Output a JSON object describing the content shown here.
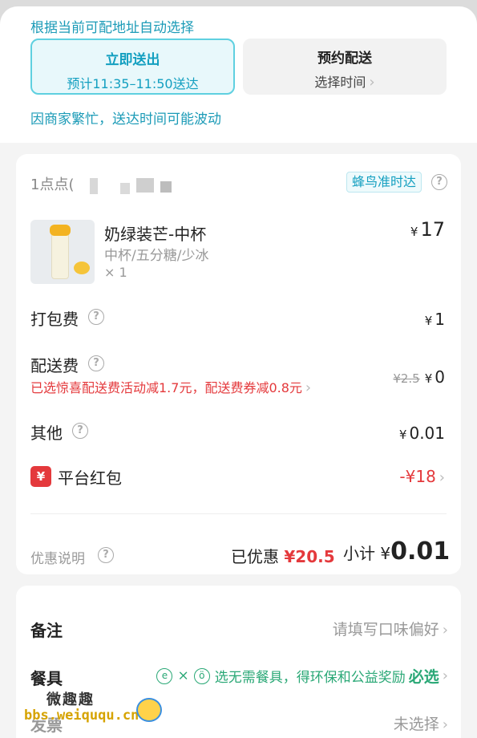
{
  "delivery": {
    "auto_hint": "根据当前可配地址自动选择",
    "now_title": "立即送出",
    "now_sub": "预计11:35–11:50送达",
    "later_title": "预约配送",
    "later_sub": "选择时间",
    "busy_hint": "因商家繁忙，送达时间可能波动"
  },
  "order": {
    "shop_name": "1点点(",
    "badge": "蜂鸟准时达",
    "product": {
      "name": "奶绿装芒-中杯",
      "spec": "中杯/五分糖/少冰",
      "qty": "× 1",
      "currency": "¥",
      "price": "17"
    },
    "packing": {
      "label": "打包费",
      "currency": "¥",
      "value": "1"
    },
    "delivery_fee": {
      "label": "配送费",
      "promo": "已选惊喜配送费活动减1.7元，配送费券减0.8元",
      "old_price": "¥2.5",
      "currency": "¥",
      "value": "0"
    },
    "other": {
      "label": "其他",
      "currency": "¥",
      "value": "0.01"
    },
    "red_packet": {
      "icon": "¥",
      "label": "平台红包",
      "value": "-¥18"
    },
    "promo_info": "优惠说明",
    "saved_label": "已优惠",
    "saved_value": "¥20.5",
    "subtotal_label": "小计",
    "subtotal_currency": "¥",
    "subtotal_value": "0.01"
  },
  "extras": {
    "note_label": "备注",
    "note_placeholder": "请填写口味偏好",
    "tableware_label": "餐具",
    "tableware_text": "选无需餐具，得环保和公益奖励",
    "tableware_must": "必选",
    "third_label": "发票",
    "third_value": "未选择"
  },
  "watermark": {
    "title": "微趣趣",
    "url": "bbs.weiququ.cn"
  },
  "colors": {
    "accent": "#139fc0",
    "red": "#e4393c",
    "green": "#2aa876"
  }
}
